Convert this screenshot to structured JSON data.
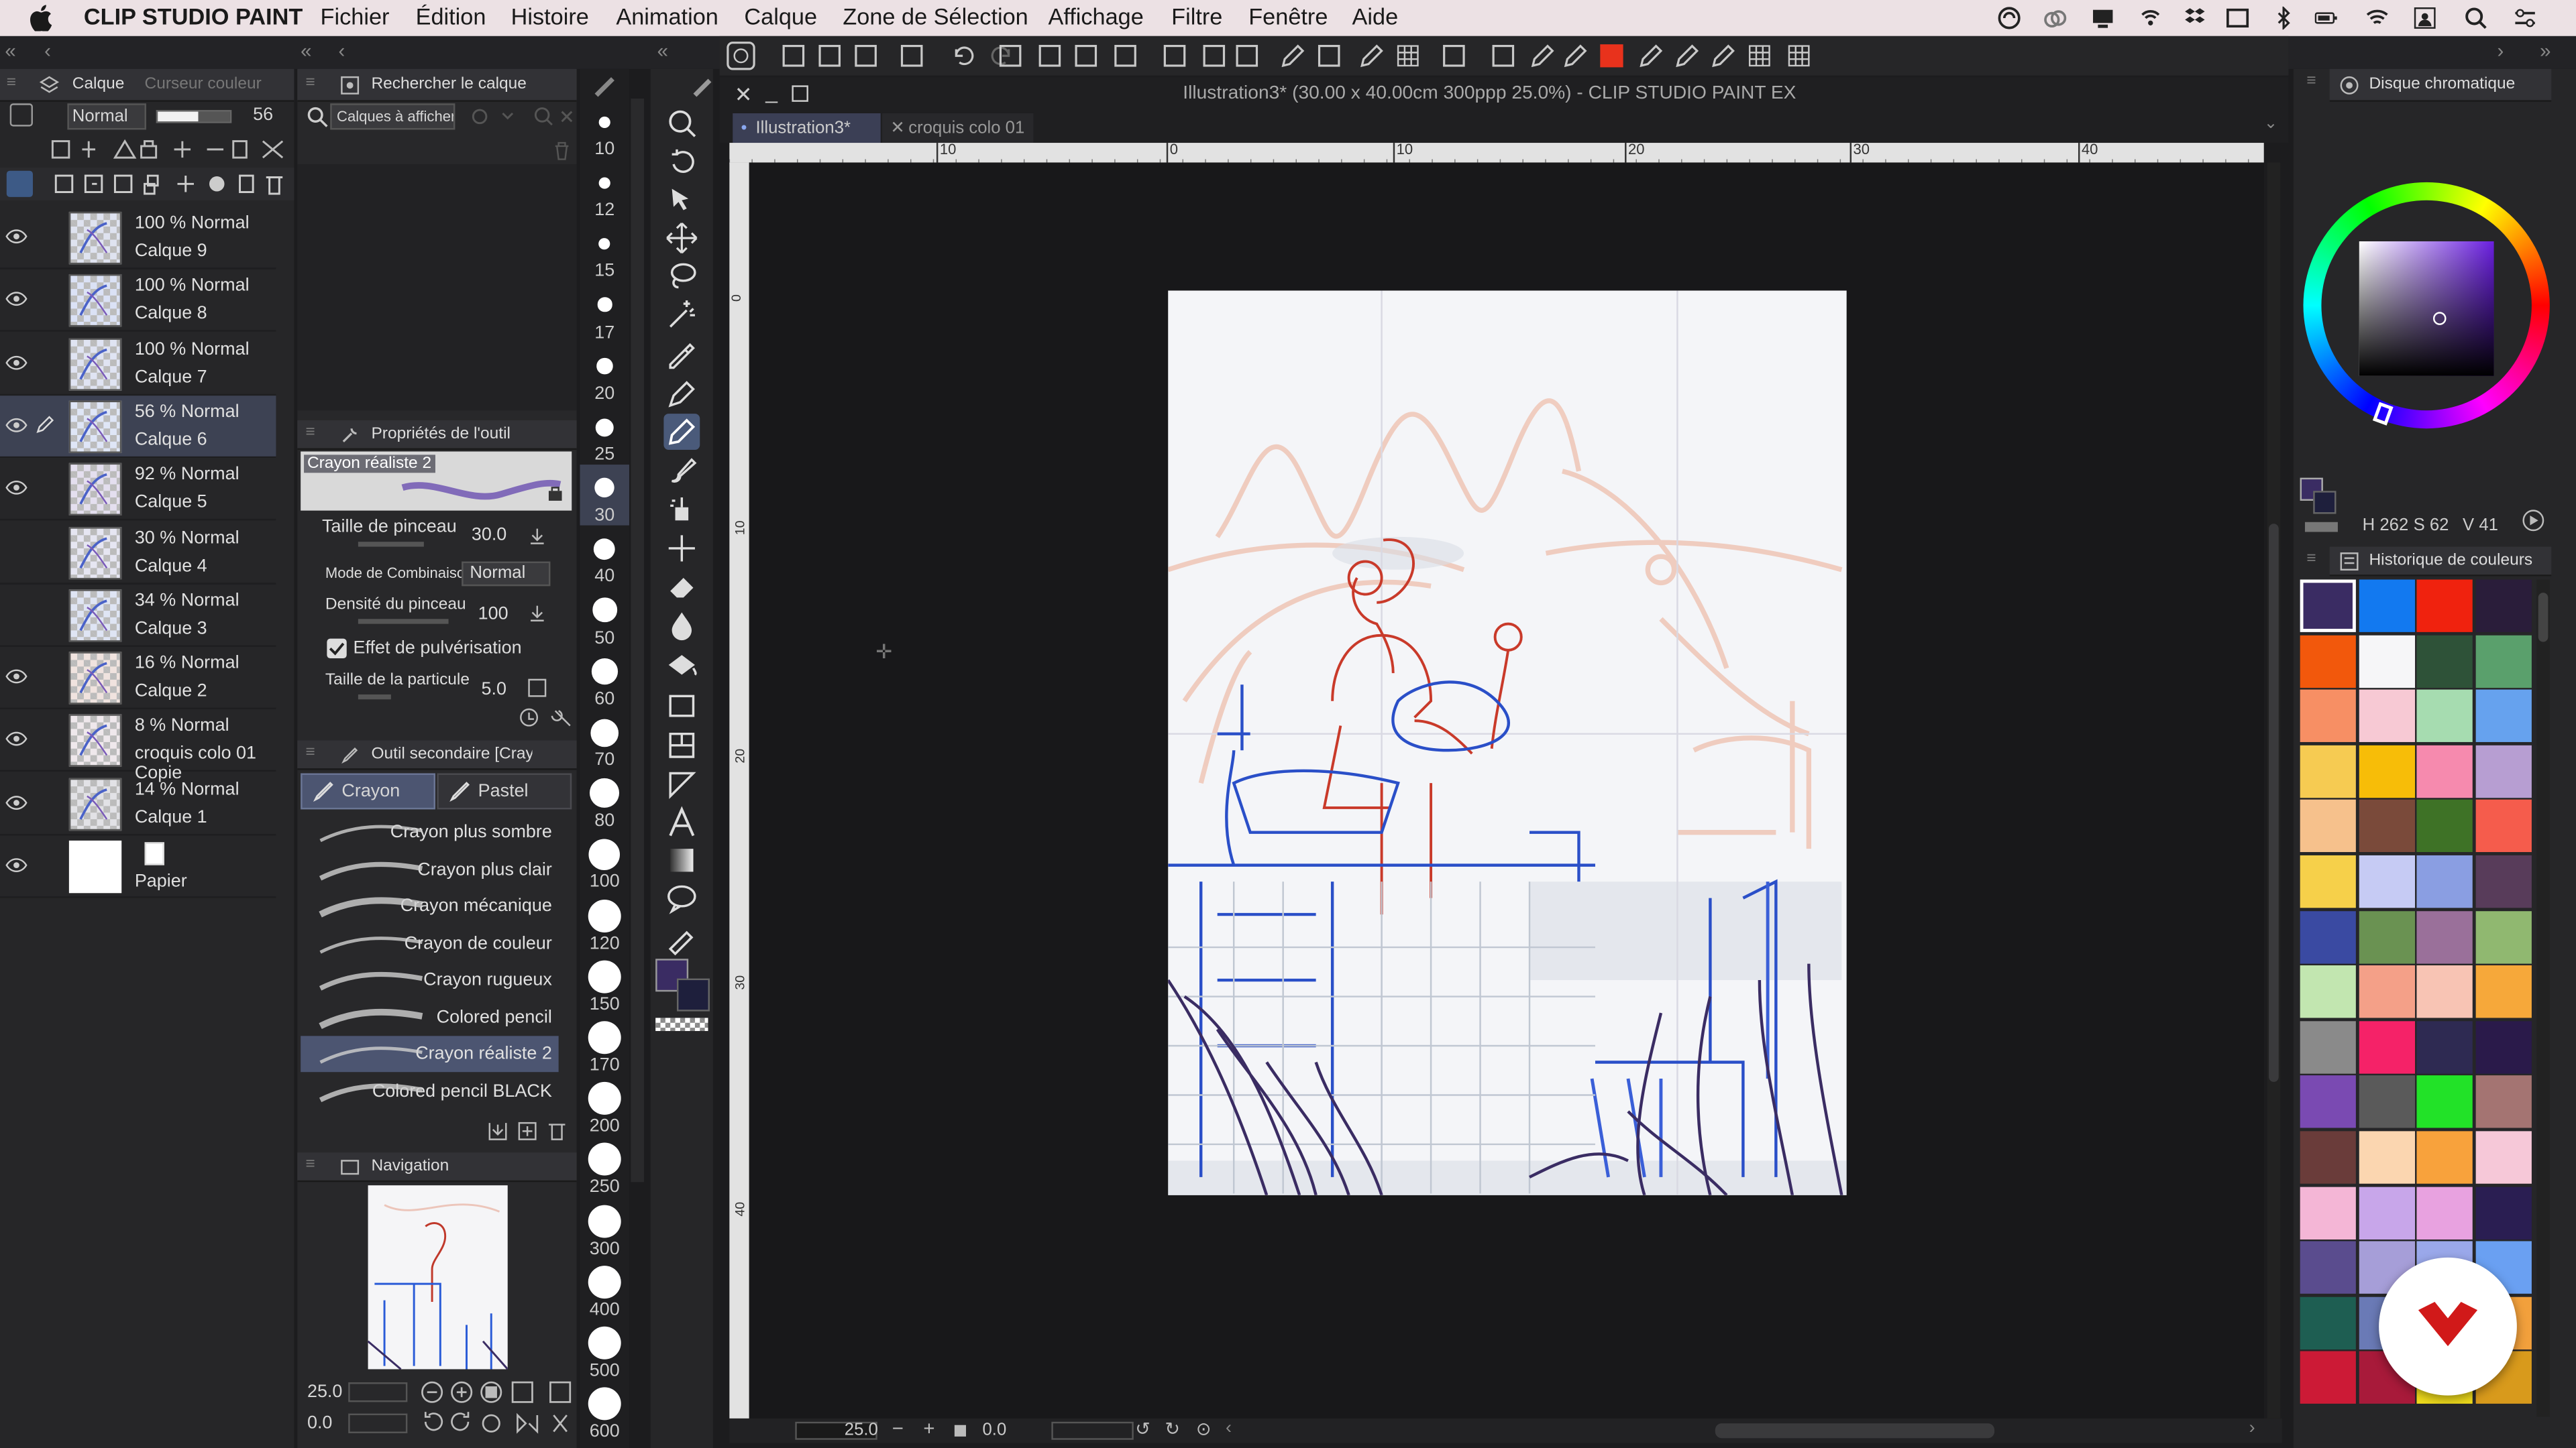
{
  "menubar": {
    "app_name": "CLIP STUDIO PAINT",
    "items": [
      "Fichier",
      "Édition",
      "Histoire",
      "Animation",
      "Calque",
      "Zone de Sélection",
      "Affichage",
      "Filtre",
      "Fenêtre",
      "Aide"
    ]
  },
  "layer_panel": {
    "tab_layer": "Calque",
    "tab_cursor": "Curseur couleur",
    "blend_mode": "Normal",
    "opacity": "56",
    "layers": [
      {
        "percent": "100 %",
        "mode": "Normal",
        "name": "Calque 9",
        "visible": true,
        "selected": false
      },
      {
        "percent": "100 %",
        "mode": "Normal",
        "name": "Calque 8",
        "visible": true,
        "selected": false
      },
      {
        "percent": "100 %",
        "mode": "Normal",
        "name": "Calque 7",
        "visible": true,
        "selected": false
      },
      {
        "percent": "56 %",
        "mode": "Normal",
        "name": "Calque 6",
        "visible": true,
        "selected": true
      },
      {
        "percent": "92 %",
        "mode": "Normal",
        "name": "Calque 5",
        "visible": true,
        "selected": false
      },
      {
        "percent": "30 %",
        "mode": "Normal",
        "name": "Calque 4",
        "visible": false,
        "selected": false
      },
      {
        "percent": "34 %",
        "mode": "Normal",
        "name": "Calque 3",
        "visible": false,
        "selected": false
      },
      {
        "percent": "16 %",
        "mode": "Normal",
        "name": "Calque 2",
        "visible": true,
        "selected": false
      },
      {
        "percent": "8 %",
        "mode": "Normal",
        "name": "croquis colo 01 Copie",
        "visible": true,
        "selected": false
      },
      {
        "percent": "14 %",
        "mode": "Normal",
        "name": "Calque 1",
        "visible": true,
        "selected": false
      },
      {
        "percent": "",
        "mode": "",
        "name": "Papier",
        "visible": true,
        "selected": false
      }
    ]
  },
  "search_panel": {
    "title": "Rechercher le calque",
    "filter": "Calques à afficher"
  },
  "tool_props": {
    "title": "Propriétés de l'outil",
    "preset": "Crayon réaliste 2",
    "rows": [
      {
        "label": "Taille de pinceau",
        "value": "30.0"
      },
      {
        "label": "Mode de Combinaison",
        "value": "Normal"
      },
      {
        "label": "Densité du pinceau",
        "value": "100"
      },
      {
        "label": "Effet de pulvérisation",
        "value": ""
      },
      {
        "label": "Taille de la particule",
        "value": "5.0"
      }
    ]
  },
  "sub_tool": {
    "title": "Outil secondaire [Crayon]",
    "tab1": "Crayon",
    "tab2": "Pastel",
    "brushes": [
      "Crayon plus sombre",
      "Crayon plus clair",
      "Crayon mécanique",
      "Crayon de couleur",
      "Crayon rugueux",
      "Colored pencil",
      "Crayon réaliste 2",
      "Colored pencil BLACK"
    ],
    "selected": "Crayon réaliste 2"
  },
  "navigator": {
    "title": "Navigation",
    "zoom": "25.0",
    "angle": "0.0"
  },
  "brush_sizes": [
    "10",
    "12",
    "15",
    "17",
    "20",
    "25",
    "30",
    "40",
    "50",
    "60",
    "70",
    "80",
    "100",
    "120",
    "150",
    "170",
    "200",
    "250",
    "300",
    "400",
    "500",
    "600"
  ],
  "brush_size_selected": "30",
  "document": {
    "window_title": "Illustration3* (30.00 x 40.00cm 300ppp 25.0%) - CLIP STUDIO PAINT EX",
    "tabs": [
      "Illustration3*",
      "croquis colo 01"
    ],
    "ruler_ticks": [
      "10",
      "0",
      "10",
      "20",
      "30",
      "40"
    ],
    "vruler_ticks": [
      "0",
      "10",
      "20",
      "30",
      "40"
    ],
    "status_zoom": "25.0",
    "status_angle": "0.0"
  },
  "color_panel": {
    "title": "Disque chromatique",
    "hsv": {
      "h": "262",
      "s": "62",
      "v": "41"
    },
    "main_color": "#3a2c63",
    "sub_color": "#1e1f3c"
  },
  "history_panel": {
    "title": "Historique de couleurs",
    "swatches": [
      "#3a2c63",
      "#1279f0",
      "#f0220e",
      "#2a1d3a",
      "#f2580c",
      "#f6f6f8",
      "#2e5238",
      "#5aa06c",
      "#f78f64",
      "#f7c9d4",
      "#a6dcb0",
      "#66a2ee",
      "#f6cb52",
      "#f7bd08",
      "#f68aae",
      "#b79ed2",
      "#f6c18c",
      "#7a4a3a",
      "#3e7226",
      "#f55c4c",
      "#f6d04a",
      "#c6cbf4",
      "#8a9ee2",
      "#583c5a",
      "#3a4aa2",
      "#6a9252",
      "#9a709a",
      "#90b870",
      "#c2e6b0",
      "#f4a088",
      "#f8c4b4",
      "#f6a83a",
      "#8a8a8a",
      "#f52268",
      "#2e2a52",
      "#2a1a4a",
      "#7a4ab2",
      "#5a5a5a",
      "#22e228",
      "#a47472",
      "#6a3c3a",
      "#fbd6b0",
      "#f8a23c",
      "#f6c8d8",
      "#f4b6d6",
      "#c8a6ea",
      "#e8a2e0",
      "#2a1e52",
      "#5a4c8e",
      "#a69ed8",
      "#9aa8ea",
      "#6aa0f2",
      "#1e5e52",
      "#6a7ab6",
      "#f5d200",
      "#f2a03c",
      "#cc1a36",
      "#a81a3a",
      "#f0dc1c",
      "#d89a1c"
    ]
  },
  "labels_small": {
    "hsv_h_prefix": "H",
    "hsv_s_prefix": "S",
    "hsv_v_prefix": "V"
  }
}
